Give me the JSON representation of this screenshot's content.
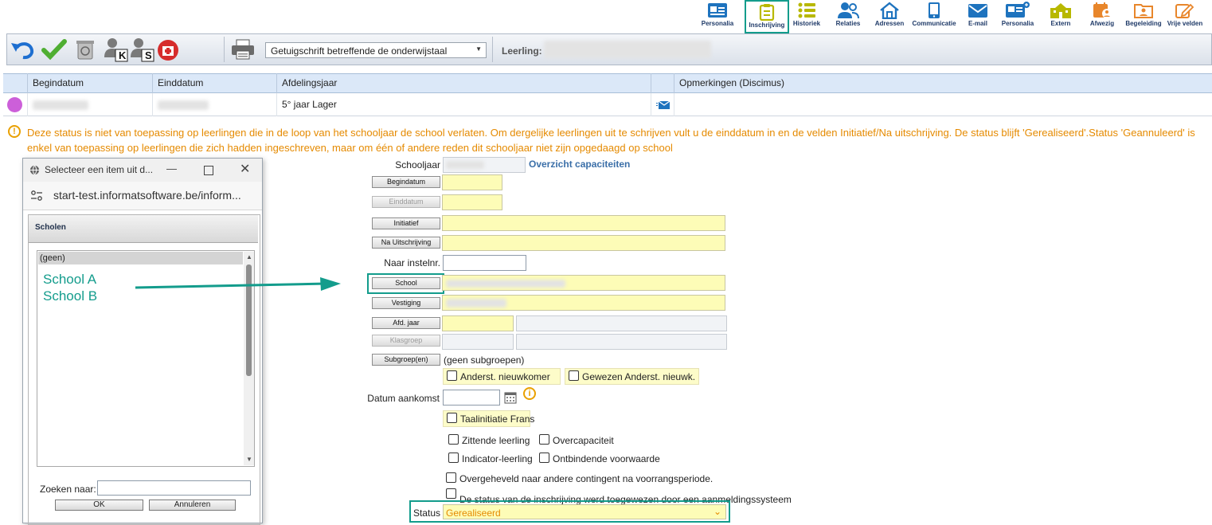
{
  "nav": {
    "items": [
      {
        "label": "Personalia",
        "icon": "id-card-icon"
      },
      {
        "label": "Inschrijving",
        "icon": "clipboard-icon"
      },
      {
        "label": "Historiek",
        "icon": "list-icon"
      },
      {
        "label": "Relaties",
        "icon": "people-icon"
      },
      {
        "label": "Adressen",
        "icon": "house-icon"
      },
      {
        "label": "Communicatie",
        "icon": "phone-icon"
      },
      {
        "label": "E-mail",
        "icon": "envelope-icon"
      },
      {
        "label": "Personalia",
        "icon": "id-card-plus-icon"
      },
      {
        "label": "Extern",
        "icon": "school-building-icon"
      },
      {
        "label": "Afwezig",
        "icon": "calendar-person-icon"
      },
      {
        "label": "Begeleiding",
        "icon": "folder-person-icon"
      },
      {
        "label": "Vrije velden",
        "icon": "edit-icon"
      }
    ],
    "active": "Inschrijving"
  },
  "toolbar": {
    "k_label": "K",
    "s_label": "S",
    "report_select": "Getuigschrift betreffende de onderwijstaal",
    "leerling_label": "Leerling:"
  },
  "table": {
    "headers": [
      "Begindatum",
      "Einddatum",
      "Afdelingsjaar",
      "",
      "Opmerkingen (Discimus)"
    ],
    "row": {
      "afdelingsjaar": "5° jaar Lager"
    }
  },
  "warning": {
    "line1": "Deze status is niet van toepassing op leerlingen die in de loop van het schooljaar de school verlaten. Om dergelijke leerlingen uit te schrijven vult u de einddatum in en de velden Initiatief/Na uitschrijving. De status blijft 'Gerealiseerd'.Status 'Geannuleerd' is",
    "line2": "enkel van toepassing op leerlingen die zich hadden ingeschreven, maar om één of andere reden dit schooljaar niet zijn opgedaagd op school"
  },
  "form": {
    "schooljaar_label": "Schooljaar",
    "capacity_link": "Overzicht capaciteiten",
    "begindatum": "Begindatum",
    "einddatum": "Einddatum",
    "initiatief": "Initiatief",
    "na_uitschrijving": "Na Uitschrijving",
    "naar_instelnr": "Naar instelnr.",
    "school": "School",
    "vestiging": "Vestiging",
    "afd_jaar": "Afd. jaar",
    "klasgroep": "Klasgroep",
    "subgroepen": "Subgroep(en)",
    "subgroepen_value": "(geen subgroepen)",
    "anderst_nieuwkomer": "Anderst. nieuwkomer",
    "gewezen_anderst": "Gewezen Anderst. nieuwk.",
    "datum_aankomst": "Datum aankomst",
    "taalinitiatie": "Taalinitiatie Frans",
    "zittende_leerling": "Zittende leerling",
    "overcapaciteit": "Overcapaciteit",
    "indicator_leerling": "Indicator-leerling",
    "ontbindende_voorwaarde": "Ontbindende voorwaarde",
    "overgeheveld": "Overgeheveld naar andere contingent na voorrangsperiode.",
    "status_toegewezen": "De status van de inschrijving werd toegewezen door een aanmeldingssysteem",
    "status_label": "Status",
    "status_value": "Gerealiseerd"
  },
  "popup": {
    "window_title": "Selecteer een item uit d...",
    "url": "start-test.informatsoftware.be/inform...",
    "header": "Scholen",
    "list_first": "(geen)",
    "annotation_line1": "School A",
    "annotation_line2": "School B",
    "search_label": "Zoeken naar:",
    "search_value": "",
    "ok_label": "OK",
    "cancel_label": "Annuleren"
  },
  "colors": {
    "accent_teal": "#139c8c",
    "warning_orange": "#e58a00",
    "field_yellow": "#fdfcb7",
    "nav_blue": "#1e73be"
  }
}
